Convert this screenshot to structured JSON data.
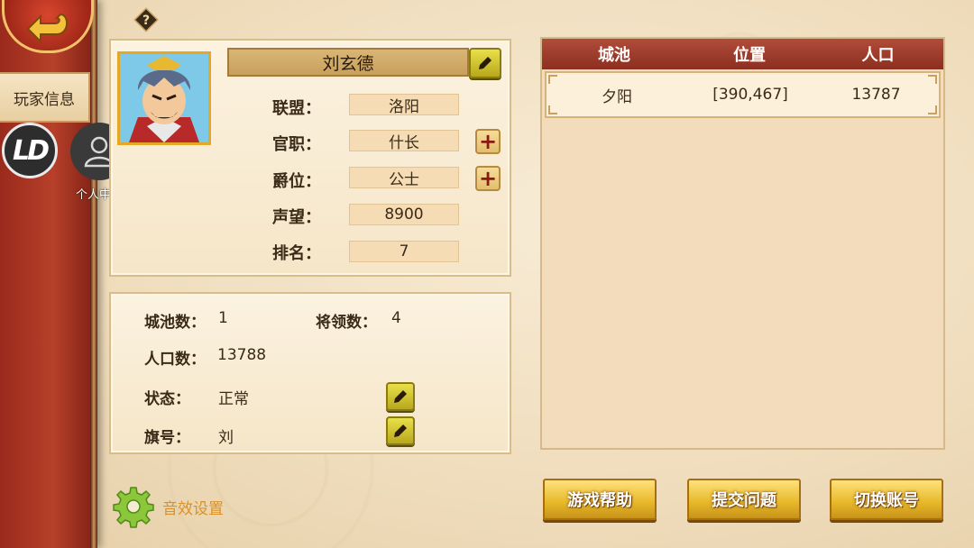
{
  "sidebar": {
    "player_tab": "玩家信息",
    "ld_label": "LD",
    "personal_center": "个人中心"
  },
  "profile": {
    "name": "刘玄德",
    "rows": [
      {
        "label": "联盟：",
        "value": "洛阳"
      },
      {
        "label": "官职：",
        "value": "什长"
      },
      {
        "label": "爵位：",
        "value": "公士"
      },
      {
        "label": "声望：",
        "value": "8900"
      },
      {
        "label": "排名：",
        "value": "7"
      }
    ]
  },
  "stats": {
    "cities_label": "城池数：",
    "cities_value": "1",
    "generals_label": "将领数：",
    "generals_value": "4",
    "population_label": "人口数：",
    "population_value": "13788",
    "status_label": "状态：",
    "status_value": "正常",
    "flag_label": "旗号：",
    "flag_value": "刘"
  },
  "city_table": {
    "headers": [
      "城池",
      "位置",
      "人口"
    ],
    "rows": [
      {
        "city": "夕阳",
        "position": "[390,467]",
        "population": "13787"
      }
    ]
  },
  "buttons": {
    "help": "游戏帮助",
    "submit": "提交问题",
    "switch": "切换账号"
  },
  "sound_settings": "音效设置",
  "colors": {
    "sidebar_red": "#9a2a1c",
    "table_header": "#8c2e20",
    "gold_button": "#e6b728",
    "edit_button": "#c8bc2a"
  }
}
